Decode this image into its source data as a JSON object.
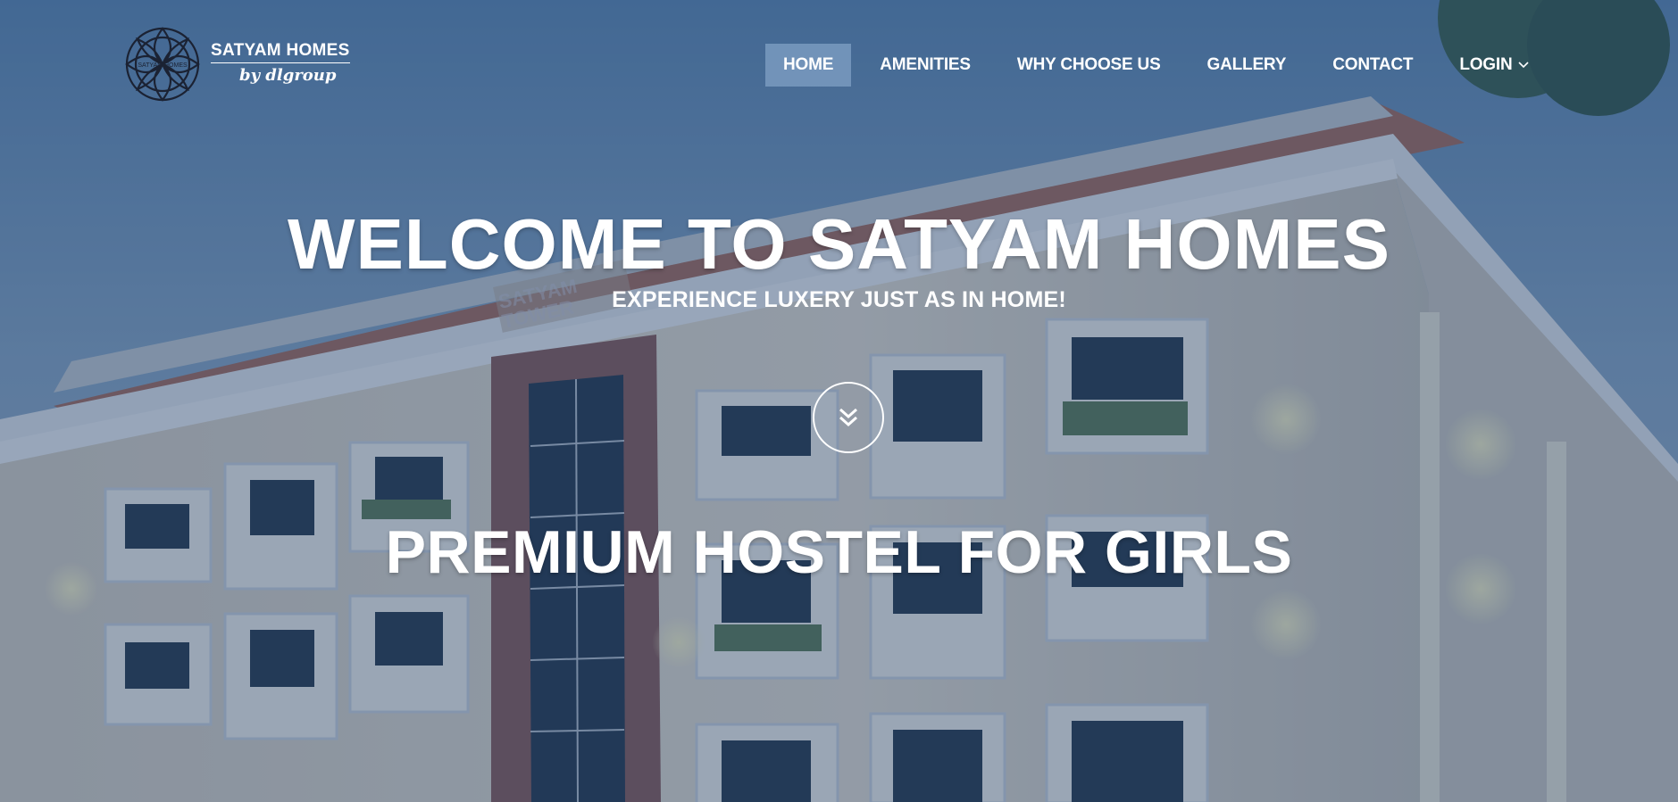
{
  "brand": {
    "name": "SATYAM HOMES",
    "tagline": "by dlgroup"
  },
  "nav": {
    "items": [
      {
        "label": "HOME",
        "active": true
      },
      {
        "label": "AMENITIES"
      },
      {
        "label": "WHY CHOOSE US"
      },
      {
        "label": "GALLERY"
      },
      {
        "label": "CONTACT"
      },
      {
        "label": "LOGIN",
        "icon": "chevron-down-icon"
      }
    ]
  },
  "hero": {
    "title": "WELCOME TO SATYAM HOMES",
    "subtitle": "EXPERIENCE LUXERY JUST AS IN HOME!",
    "scroll_icon": "double-chevron-down-icon",
    "tagline": "PREMIUM HOSTEL FOR GIRLS",
    "sign_text": "SATYAM TOWER"
  },
  "colors": {
    "overlay": "#1c3e69",
    "nav_active": "#96b4d7",
    "text": "#ffffff"
  }
}
